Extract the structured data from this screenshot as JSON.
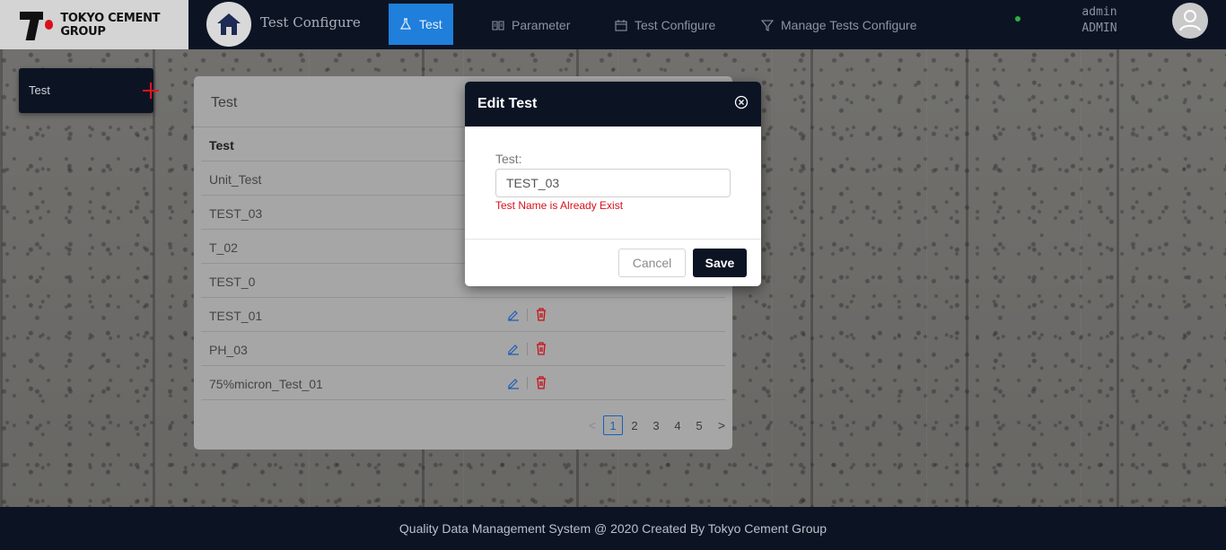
{
  "header": {
    "logo_text": "TOKYO CEMENT GROUP",
    "app_title": "Test Configure",
    "nav": [
      {
        "label": "Test",
        "icon": "flask-icon",
        "active": true
      },
      {
        "label": "Parameter",
        "icon": "book-icon",
        "active": false
      },
      {
        "label": "Test Configure",
        "icon": "calendar-icon",
        "active": false
      },
      {
        "label": "Manage Tests Configure",
        "icon": "filter-icon",
        "active": false
      }
    ],
    "user": {
      "name": "admin",
      "role": "ADMIN"
    }
  },
  "sidebar": {
    "card_label": "Test"
  },
  "table_card": {
    "title": "Test",
    "column_header": "Test",
    "rows": [
      "Unit_Test",
      "TEST_03",
      "T_02",
      "TEST_0",
      "TEST_01",
      "PH_03",
      "75%micron_Test_01"
    ],
    "pagination": {
      "pages": [
        "1",
        "2",
        "3",
        "4",
        "5"
      ],
      "current": "1",
      "prev": "<",
      "next": ">"
    }
  },
  "modal": {
    "title": "Edit Test",
    "field_label": "Test:",
    "field_value": "TEST_03",
    "error": "Test Name is Already Exist",
    "cancel_label": "Cancel",
    "save_label": "Save"
  },
  "footer": {
    "text": "Quality Data Management System @ 2020 Created By Tokyo Cement Group"
  },
  "colors": {
    "navy": "#0c1424",
    "active_nav": "#1f7fdb",
    "error": "#d8101a",
    "brand_red": "#e0141e"
  }
}
